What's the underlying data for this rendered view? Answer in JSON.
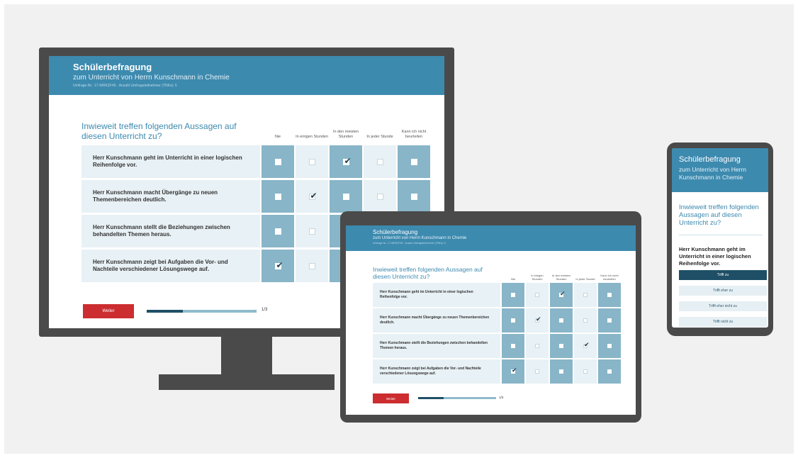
{
  "survey": {
    "title": "Schülerbefragung",
    "subtitle": "zum Unterricht von Herrn Kunschmann in Chemie",
    "meta": "Umfrage-Nr.: 17-WRKZF45 · Anzahl Umfrageteilnehmer (TNKs): 5",
    "question": "Inwieweit treffen folgenden Aussagen auf diesen Unterricht zu?",
    "columns": [
      "Nie",
      "In einigen Stunden",
      "In den meisten Stunden",
      "In jeder Stunde",
      "Kann ich nicht beurteilen"
    ],
    "statements": [
      "Herr Kunschmann geht im Unterricht in einer logischen Reihenfolge vor.",
      "Herr Kunschmann macht Übergänge zu neuen Themenbereichen deutlich.",
      "Herr Kunschmann stellt die Beziehungen zwischen behandelten Themen heraus.",
      "Herr Kunschmann zeigt bei Aufgaben die Vor- und Nachteile verschiedener Lösungswege auf."
    ],
    "next_button": "Weiter",
    "page_indicator": "1/3",
    "progress": 0.33
  },
  "monitor": {
    "answers": [
      2,
      1,
      null,
      0
    ]
  },
  "tablet": {
    "answers": [
      2,
      1,
      3,
      0
    ]
  },
  "phone": {
    "title": "Schülerbefragung",
    "subtitle": "zum Unterricht von Herrn Kunschmann in Chemie",
    "question": "Inwieweit treffen folgenden Aussagen auf diesen Unterricht zu?",
    "statement": "Herr Kunschmann geht im Unterricht in einer logischen Reihenfolge vor.",
    "options": [
      "Trifft zu",
      "Trifft eher zu",
      "Trifft eher nicht zu",
      "Trifft nicht zu"
    ],
    "selected": 0
  }
}
